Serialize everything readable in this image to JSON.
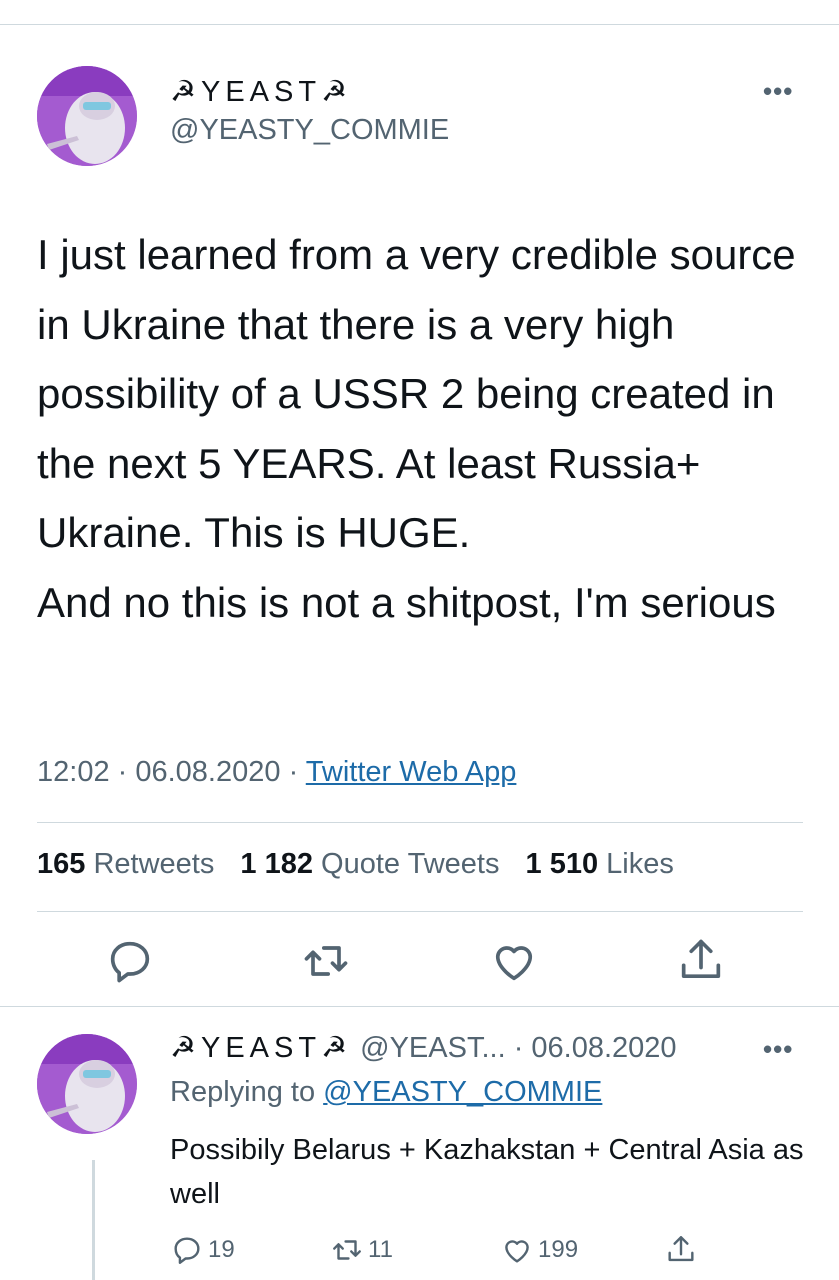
{
  "tweet": {
    "display_name": "☭YEAST☭",
    "handle": "@YEASTY_COMMIE",
    "more_label": "•••",
    "text": "I just learned from a very credible source in Ukraine that there is a very high possibility of a USSR 2 being created in the next 5 YEARS. At least Russia+ Ukraine. This is HUGE.\nAnd no this is not a shitpost, I'm serious",
    "time": "12:02",
    "dot1": " · ",
    "date": "06.08.2020",
    "dot2": " · ",
    "source": "Twitter Web App",
    "stats": {
      "retweets_count": "165",
      "retweets_label": "Retweets",
      "quotes_count": "1 182",
      "quotes_label": "Quote Tweets",
      "likes_count": "1 510",
      "likes_label": "Likes"
    },
    "icons": [
      "reply-icon",
      "retweet-icon",
      "like-icon",
      "share-icon"
    ]
  },
  "reply": {
    "display_name": "☭YEAST☭",
    "handle_date": " @YEAST... · 06.08.2020",
    "more_label": "•••",
    "replying_prefix": "Replying to ",
    "replying_to": "@YEASTY_COMMIE",
    "text": "Possibily Belarus + Kazhakstan + Central Asia as well",
    "reply_count": "19",
    "retweet_count": "11",
    "like_count": "199"
  },
  "colors": {
    "text": "#0f1419",
    "secondary": "#536471",
    "link": "#1d6ba8",
    "divider": "#cfd9de",
    "avatar_purple": "#9b56c4"
  }
}
